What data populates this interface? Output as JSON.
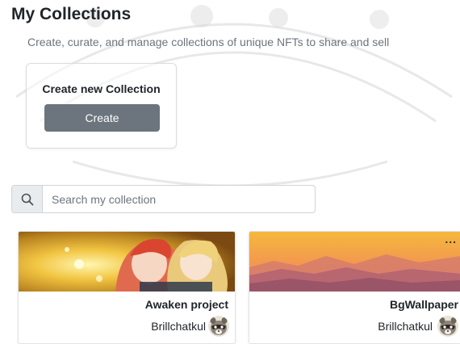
{
  "page": {
    "title": "My Collections",
    "subtitle": "Create, curate, and manage collections of unique NFTs to share and sell"
  },
  "create_card": {
    "title": "Create new Collection",
    "button_label": "Create"
  },
  "search": {
    "placeholder": "Search my collection",
    "value": "",
    "icon": "search-icon"
  },
  "collections": [
    {
      "name": "Awaken project",
      "owner": "Brillchatkul",
      "cover": "anime-illustration",
      "avatar": "raccoon-avatar"
    },
    {
      "name": "BgWallpaper",
      "owner": "Brillchatkul",
      "cover": "sunset-mountains",
      "avatar": "raccoon-avatar",
      "menu_label": "..."
    }
  ],
  "colors": {
    "button": "#6c757d",
    "text": "#212529",
    "muted": "#6c757d",
    "border": "#ced4da"
  }
}
